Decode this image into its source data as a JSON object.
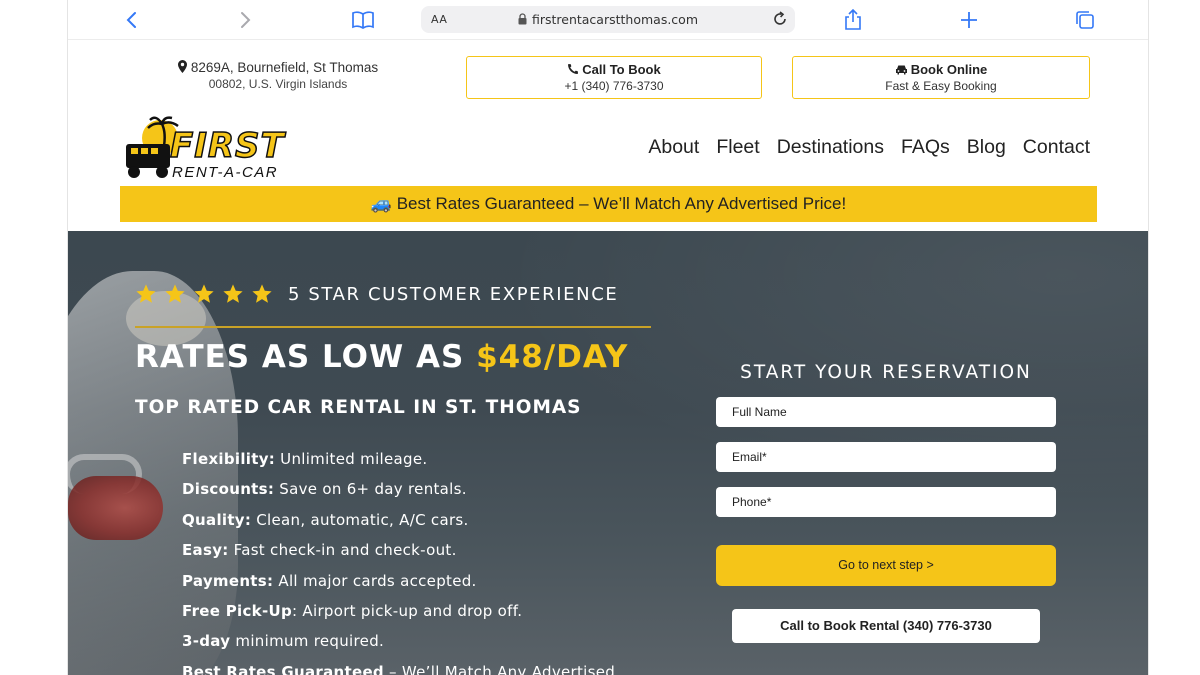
{
  "browser": {
    "text_size_label": "AA",
    "url": "firstrentacarstthomas.com"
  },
  "contact": {
    "address_line1": "8269A, Bournefield, St Thomas",
    "address_line2": "00802, U.S. Virgin Islands",
    "call_title": "Call To Book",
    "call_number": "+1 (340) 776-3730",
    "book_title": "Book Online",
    "book_sub": "Fast & Easy Booking"
  },
  "logo": {
    "word": "FIRST",
    "sub": "RENT-A-CAR"
  },
  "nav": {
    "items": [
      "About",
      "Fleet",
      "Destinations",
      "FAQs",
      "Blog",
      "Contact"
    ]
  },
  "promo": {
    "icon": "🚙",
    "text": "Best Rates Guaranteed – We’ll Match Any Advertised Price!"
  },
  "hero": {
    "rating": 5,
    "stars_text": "5 STAR CUSTOMER EXPERIENCE",
    "headline_prefix": "RATES AS LOW AS ",
    "headline_price": "$48/DAY",
    "subhead": "TOP RATED CAR RENTAL IN ST. THOMAS",
    "features": [
      {
        "label": "Flexibility:",
        "text": " Unlimited mileage."
      },
      {
        "label": "Discounts:",
        "text": " Save on 6+ day rentals."
      },
      {
        "label": "Quality:",
        "text": " Clean, automatic, A/C cars."
      },
      {
        "label": "Easy:",
        "text": " Fast check-in and check-out."
      },
      {
        "label": "Payments:",
        "text": " All major cards accepted."
      },
      {
        "label": "Free Pick-Up",
        "text": ": Airport pick-up and drop off."
      },
      {
        "label": "3-day",
        "text": " minimum required."
      },
      {
        "label": "Best Rates Guaranteed",
        "text": " – We’ll Match Any Advertised"
      }
    ]
  },
  "form": {
    "title": "START YOUR RESERVATION",
    "name_placeholder": "Full Name",
    "email_placeholder": "Email*",
    "phone_placeholder": "Phone*",
    "next_label": "Go to next step >",
    "call_label": "Call to Book Rental (340) 776-3730"
  },
  "colors": {
    "accent_yellow": "#f5c518",
    "safari_blue": "#3478f6",
    "hero_overlay": "#3f4a52"
  }
}
